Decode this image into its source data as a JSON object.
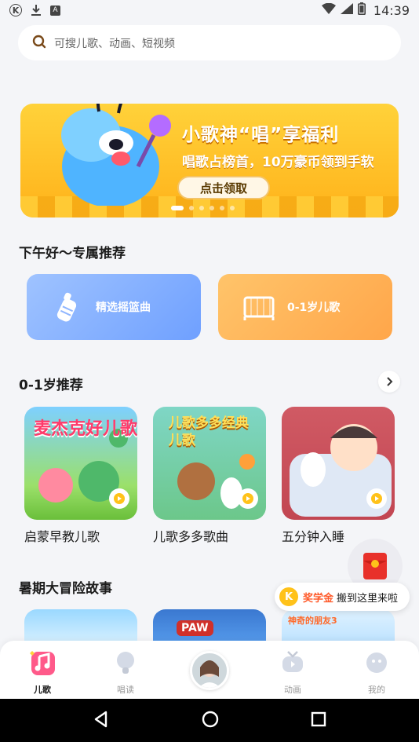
{
  "status_bar": {
    "time": "14:39",
    "notif_letters": [
      "K",
      "A"
    ]
  },
  "search": {
    "placeholder": "可搜儿歌、动画、短视频"
  },
  "banner": {
    "title": "小歌神“唱”享福利",
    "subtitle": "唱歌占榜首，10万豪币领到手软",
    "button": "点击领取",
    "pages": 6,
    "active_page": 1
  },
  "greeting": {
    "title": "下午好～专属推荐"
  },
  "quick_cards": [
    {
      "label": "精选摇篮曲",
      "icon": "baby-bottle-icon",
      "color": "#7fa8ff"
    },
    {
      "label": "0-1岁儿歌",
      "icon": "crib-icon",
      "color": "#ffb04f"
    }
  ],
  "section_0_1": {
    "title": "0-1岁推荐",
    "items": [
      {
        "label": "启蒙早教儿歌",
        "cover_text": "麦杰克好儿歌"
      },
      {
        "label": "儿歌多多歌曲",
        "cover_text": "儿歌多多经典儿歌"
      },
      {
        "label": "五分钟入睡"
      }
    ]
  },
  "section_summer": {
    "title": "暑期大冒险故事",
    "items": [
      {
        "cover_text": ""
      },
      {
        "cover_text": "PAW"
      },
      {
        "cover_text": "神奇的朋友3"
      }
    ]
  },
  "reward": {
    "highlight": "奖学金",
    "text": "搬到这里来啦",
    "coin": "K"
  },
  "tabs": [
    {
      "label": "儿歌",
      "active": true
    },
    {
      "label": "唱读",
      "active": false
    },
    {
      "label": "动画",
      "active": false
    },
    {
      "label": "我的",
      "active": false
    }
  ],
  "colors": {
    "accent": "#ffb21a",
    "pink": "#ff5a8a",
    "reward": "#ff5a2a"
  }
}
